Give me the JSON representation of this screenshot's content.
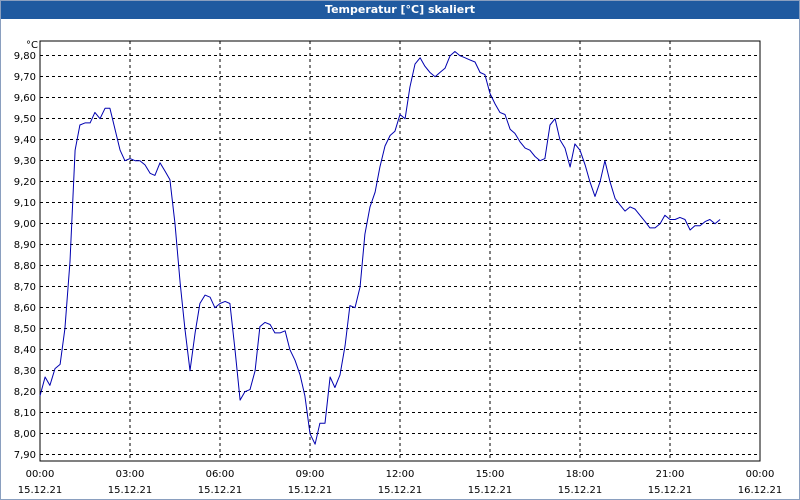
{
  "window": {
    "title": "Temperatur [°C] skaliert"
  },
  "colors": {
    "titlebar": "#1f5aa0",
    "line": "#0000b0",
    "grid": "#000000"
  },
  "chart_data": {
    "type": "line",
    "title": "Temperatur [°C] skaliert",
    "ylabel": "°C",
    "xlabel": "",
    "grid": true,
    "ylim": [
      7.87,
      9.87
    ],
    "xlim_hours": [
      0,
      24
    ],
    "y_ticks": [
      "9,80",
      "9,70",
      "9,60",
      "9,50",
      "9,40",
      "9,30",
      "9,20",
      "9,10",
      "9,00",
      "8,90",
      "8,80",
      "8,70",
      "8,60",
      "8,50",
      "8,40",
      "8,30",
      "8,20",
      "8,10",
      "8,00",
      "7,90"
    ],
    "y_tick_values": [
      9.8,
      9.7,
      9.6,
      9.5,
      9.4,
      9.3,
      9.2,
      9.1,
      9.0,
      8.9,
      8.8,
      8.7,
      8.6,
      8.5,
      8.4,
      8.3,
      8.2,
      8.1,
      8.0,
      7.9
    ],
    "x_ticks": [
      {
        "time": "00:00",
        "date": "15.12.21",
        "hour": 0
      },
      {
        "time": "03:00",
        "date": "15.12.21",
        "hour": 3
      },
      {
        "time": "06:00",
        "date": "15.12.21",
        "hour": 6
      },
      {
        "time": "09:00",
        "date": "15.12.21",
        "hour": 9
      },
      {
        "time": "12:00",
        "date": "15.12.21",
        "hour": 12
      },
      {
        "time": "15:00",
        "date": "15.12.21",
        "hour": 15
      },
      {
        "time": "18:00",
        "date": "15.12.21",
        "hour": 18
      },
      {
        "time": "21:00",
        "date": "15.12.21",
        "hour": 21
      },
      {
        "time": "00:00",
        "date": "16.12.21",
        "hour": 24
      }
    ],
    "series": [
      {
        "x_hours": [
          0.0,
          0.17,
          0.33,
          0.5,
          0.67,
          0.83,
          1.0,
          1.17,
          1.33,
          1.5,
          1.67,
          1.83,
          2.0,
          2.17,
          2.33,
          2.5,
          2.67,
          2.83,
          3.0,
          3.17,
          3.33,
          3.5,
          3.67,
          3.83,
          4.0,
          4.17,
          4.33,
          4.5,
          4.67,
          4.83,
          5.0,
          5.17,
          5.33,
          5.5,
          5.67,
          5.83,
          6.0,
          6.17,
          6.33,
          6.5,
          6.67,
          6.83,
          7.0,
          7.17,
          7.33,
          7.5,
          7.67,
          7.83,
          8.0,
          8.17,
          8.33,
          8.5,
          8.67,
          8.83,
          9.0,
          9.17,
          9.33,
          9.5,
          9.67,
          9.83,
          10.0,
          10.17,
          10.33,
          10.5,
          10.67,
          10.83,
          11.0,
          11.17,
          11.33,
          11.5,
          11.67,
          11.83,
          12.0,
          12.17,
          12.33,
          12.5,
          12.67,
          12.83,
          13.0,
          13.17,
          13.33,
          13.5,
          13.67,
          13.83,
          14.0,
          14.17,
          14.33,
          14.5,
          14.67,
          14.83,
          15.0,
          15.17,
          15.33,
          15.5,
          15.67,
          15.83,
          16.0,
          16.17,
          16.33,
          16.5,
          16.67,
          16.83,
          17.0,
          17.17,
          17.33,
          17.5,
          17.67,
          17.83,
          18.0,
          18.17,
          18.33,
          18.5,
          18.67,
          18.83,
          19.0,
          19.17,
          19.33,
          19.5,
          19.67,
          19.83,
          20.0,
          20.17,
          20.33,
          20.5,
          20.67,
          20.83,
          21.0,
          21.17,
          21.33,
          21.5,
          21.67,
          21.83,
          22.0,
          22.17,
          22.33,
          22.5,
          22.67,
          22.83,
          23.0,
          23.17,
          23.33,
          23.5,
          23.67,
          23.83,
          24.0
        ],
        "values": [
          8.18,
          8.27,
          8.23,
          8.31,
          8.33,
          8.5,
          8.82,
          9.35,
          9.47,
          9.48,
          9.48,
          9.53,
          9.5,
          9.55,
          9.55,
          9.45,
          9.35,
          9.3,
          9.31,
          9.3,
          9.3,
          9.28,
          9.24,
          9.23,
          9.29,
          9.25,
          9.21,
          9.0,
          8.72,
          8.5,
          8.3,
          8.48,
          8.62,
          8.66,
          8.65,
          8.6,
          8.62,
          8.63,
          8.62,
          8.4,
          8.16,
          8.2,
          8.21,
          8.3,
          8.51,
          8.53,
          8.52,
          8.48,
          8.48,
          8.49,
          8.4,
          8.35,
          8.28,
          8.18,
          8.0,
          7.95,
          8.05,
          8.05,
          8.27,
          8.22,
          8.28,
          8.42,
          8.61,
          8.6,
          8.7,
          8.95,
          9.08,
          9.15,
          9.27,
          9.37,
          9.42,
          9.44,
          9.52,
          9.5,
          9.65,
          9.76,
          9.79,
          9.75,
          9.72,
          9.7,
          9.72,
          9.74,
          9.8,
          9.82,
          9.8,
          9.79,
          9.78,
          9.77,
          9.72,
          9.71,
          9.62,
          9.57,
          9.53,
          9.52,
          9.45,
          9.43,
          9.39,
          9.36,
          9.35,
          9.32,
          9.3,
          9.31,
          9.47,
          9.5,
          9.4,
          9.36,
          9.27,
          9.38,
          9.35,
          9.28,
          9.2,
          9.13,
          9.2,
          9.3,
          9.2,
          9.12,
          9.09,
          9.06,
          9.08,
          9.07,
          9.04,
          9.01,
          8.98,
          8.98,
          9.0,
          9.04,
          9.02,
          9.02,
          9.03,
          9.02,
          8.97,
          8.99,
          8.99,
          9.01,
          9.02,
          9.0,
          9.02
        ]
      }
    ]
  }
}
